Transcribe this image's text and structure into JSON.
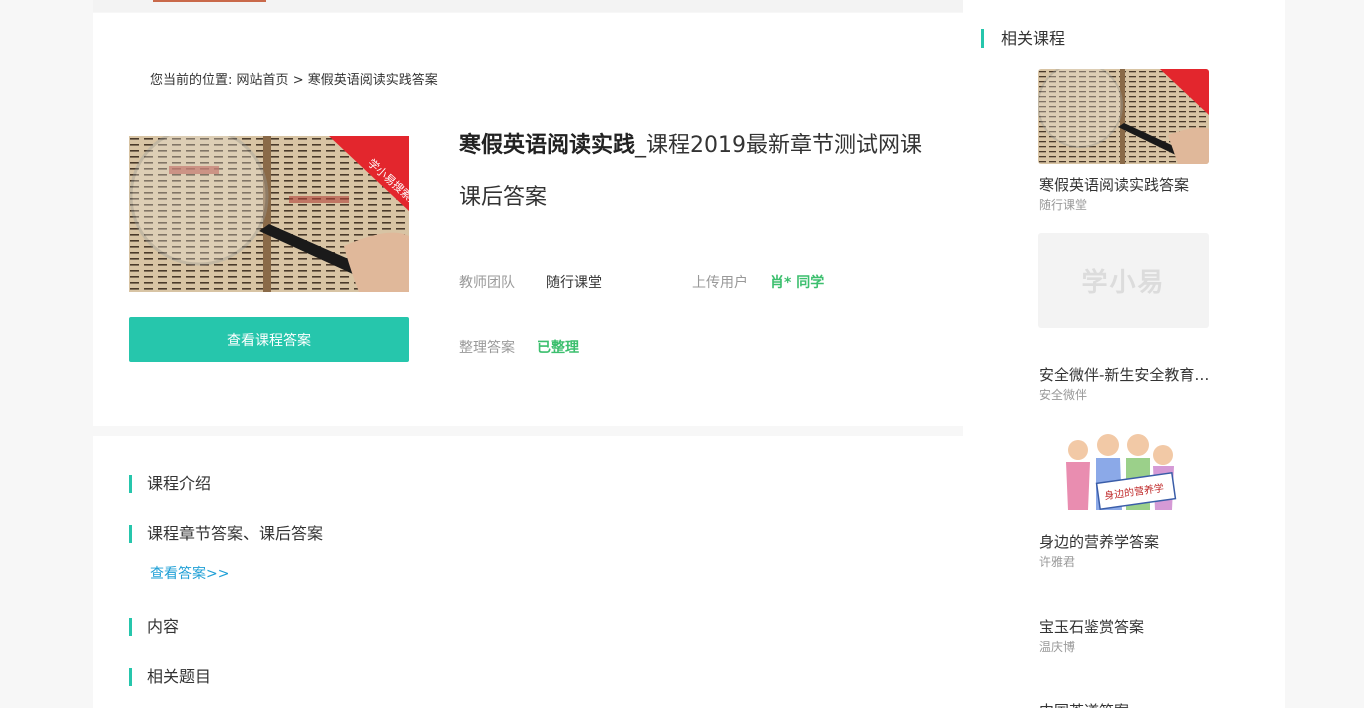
{
  "breadcrumb": {
    "prefix": "您当前的位置:",
    "home": "网站首页",
    "separator": ">",
    "current": "寒假英语阅读实践答案"
  },
  "course": {
    "title_bold": "寒假英语阅读实践",
    "title_rest": "_课程2019最新章节测试网课课后答案",
    "banner_tag": "学小易搜索题库",
    "teacher_label": "教师团队",
    "teacher_value": "随行课堂",
    "uploader_label": "上传用户",
    "uploader_value": "肖* 同学",
    "status_label": "整理答案",
    "status_value": "已整理",
    "answer_button": "查看课程答案"
  },
  "sections": {
    "intro": "课程介绍",
    "chapters": "课程章节答案、课后答案",
    "view_link": "查看答案>>",
    "content": "内容",
    "related_questions": "相关题目"
  },
  "sidebar": {
    "heading": "相关课程",
    "items": [
      {
        "title": "寒假英语阅读实践答案",
        "author": "随行课堂",
        "thumb": "magnifier-book"
      },
      {
        "title": "安全微伴-新生安全教育答案",
        "author": "安全微伴",
        "thumb": "placeholder",
        "placeholder_text": "学小易"
      },
      {
        "title": "身边的营养学答案",
        "author": "许雅君",
        "thumb": "cartoon-nutrition",
        "thumb_text": "身边的营养学"
      },
      {
        "title": "宝玉石鉴赏答案",
        "author": "温庆博"
      },
      {
        "title": "中国茶道答案"
      }
    ]
  },
  "colors": {
    "accent": "#26c6ac",
    "green_text": "#3cbf6e",
    "link": "#1e9fd6"
  }
}
